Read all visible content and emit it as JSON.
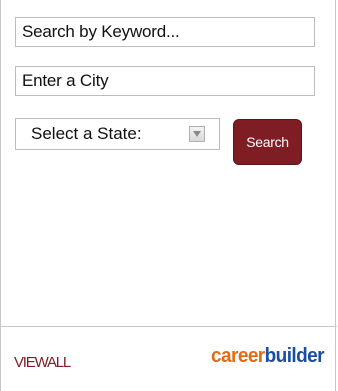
{
  "search": {
    "keyword_placeholder": "Search by Keyword...",
    "city_placeholder": "Enter a City",
    "state_select_label": "Select a State:",
    "button_label": "Search"
  },
  "footer": {
    "view_all_label": "VIEWALL",
    "logo_part_career": "career",
    "logo_part_builder": "builder"
  },
  "colors": {
    "button_bg": "#7f1d24",
    "link": "#7f1d24",
    "logo_orange": "#e36b16",
    "logo_blue": "#1b4ea0"
  },
  "icons": {
    "select_arrow": "chevron-down-icon"
  }
}
